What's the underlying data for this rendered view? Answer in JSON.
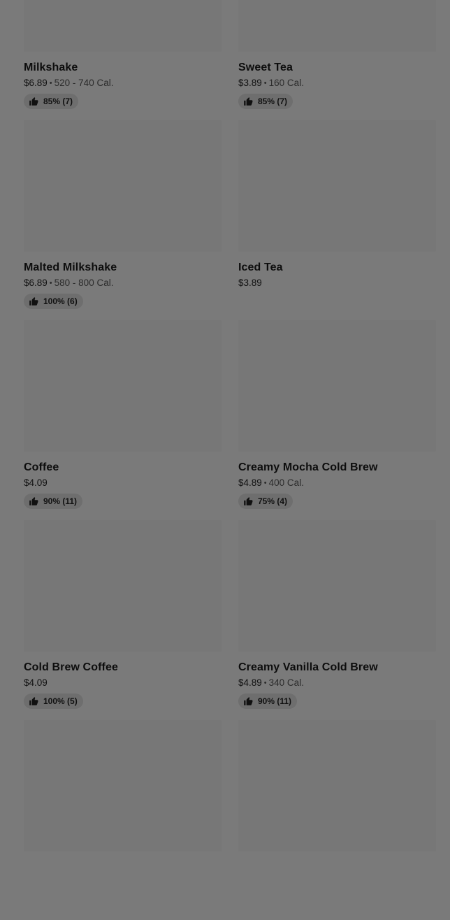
{
  "menu_items": [
    {
      "name": "Milkshake",
      "price": "$6.89",
      "calories": "520 - 740 Cal.",
      "rating": "85% (7)"
    },
    {
      "name": "Sweet Tea",
      "price": "$3.89",
      "calories": "160 Cal.",
      "rating": "85% (7)"
    },
    {
      "name": "Malted Milkshake",
      "price": "$6.89",
      "calories": "580 - 800 Cal.",
      "rating": "100% (6)"
    },
    {
      "name": "Iced Tea",
      "price": "$3.89",
      "calories": "",
      "rating": ""
    },
    {
      "name": "Coffee",
      "price": "$4.09",
      "calories": "",
      "rating": "90% (11)"
    },
    {
      "name": "Creamy Mocha Cold Brew",
      "price": "$4.89",
      "calories": "400 Cal.",
      "rating": "75% (4)"
    },
    {
      "name": "Cold Brew Coffee",
      "price": "$4.09",
      "calories": "",
      "rating": "100% (5)"
    },
    {
      "name": "Creamy Vanilla Cold Brew",
      "price": "$4.89",
      "calories": "340 Cal.",
      "rating": "90% (11)"
    },
    {
      "name": "",
      "price": "",
      "calories": "",
      "rating": ""
    },
    {
      "name": "",
      "price": "",
      "calories": "",
      "rating": ""
    }
  ]
}
